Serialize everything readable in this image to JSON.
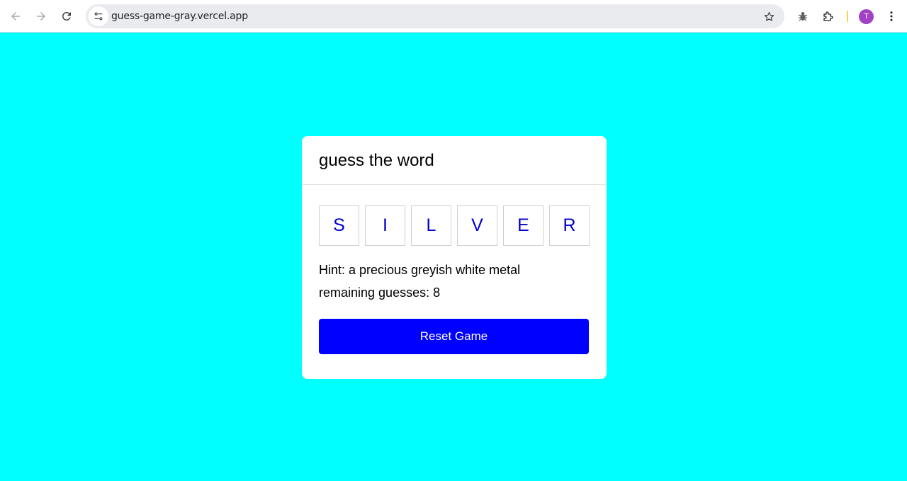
{
  "browser": {
    "url": "guess-game-gray.vercel.app",
    "avatar_initial": "T",
    "icons": [
      "back-arrow-icon",
      "forward-arrow-icon",
      "reload-icon",
      "site-info-icon",
      "star-icon",
      "bug-extension-icon",
      "puzzle-extension-icon",
      "kebab-menu-icon"
    ]
  },
  "page": {
    "background_color": "#00ffff",
    "accent_color": "#0000ff"
  },
  "game": {
    "title": "guess the word",
    "letters": [
      "S",
      "I",
      "L",
      "V",
      "E",
      "R"
    ],
    "hint": "Hint: a precious greyish white metal",
    "remaining": "remaining guesses: 8",
    "reset_label": "Reset Game"
  }
}
